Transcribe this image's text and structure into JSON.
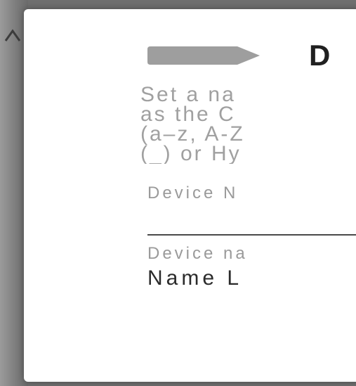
{
  "dialog": {
    "title": "D",
    "description_lines": [
      "Set a na",
      "as the C",
      "(a–z, A-Z",
      "(_) or Hy"
    ],
    "field_label": "Device N",
    "field_value": "",
    "hint_label": "Device na",
    "hint_value": "Name L"
  },
  "icons": {
    "background_glyph": "chevron-icon",
    "title_badge": "arrow-badge-icon"
  },
  "colors": {
    "dialog_bg": "#ffffff",
    "overlay": "#6f6f6f",
    "badge": "#9e9e9e"
  }
}
